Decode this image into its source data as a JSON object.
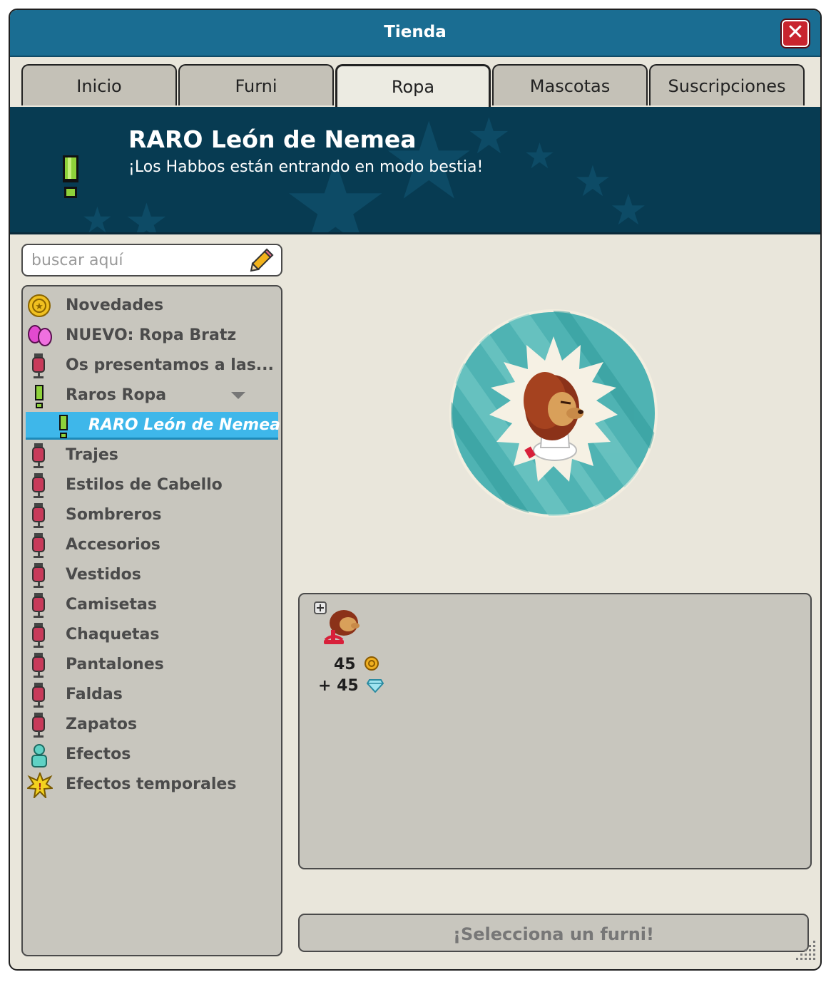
{
  "window": {
    "title": "Tienda",
    "close_label": "✕"
  },
  "tabs": [
    {
      "label": "Inicio",
      "active": false
    },
    {
      "label": "Furni",
      "active": false
    },
    {
      "label": "Ropa",
      "active": true
    },
    {
      "label": "Mascotas",
      "active": false
    },
    {
      "label": "Suscripciones",
      "active": false
    }
  ],
  "banner": {
    "title": "RARO León de Nemea",
    "subtitle": "¡Los Habbos están entrando en modo bestia!"
  },
  "search": {
    "placeholder": "buscar aquí",
    "value": ""
  },
  "categories": [
    {
      "label": "Novedades",
      "icon": "coin-star-icon"
    },
    {
      "label": "NUEVO: Ropa Bratz",
      "icon": "pink-shoes-icon"
    },
    {
      "label": "Os presentamos a las... ¡BR",
      "icon": "mannequin-icon"
    },
    {
      "label": "Raros Ropa",
      "icon": "exclamation-icon",
      "expanded": true
    },
    {
      "label": "RARO León de Nemea",
      "icon": "exclamation-icon",
      "selected": true
    },
    {
      "label": "Trajes",
      "icon": "mannequin-icon"
    },
    {
      "label": "Estilos de Cabello",
      "icon": "mannequin-icon"
    },
    {
      "label": "Sombreros",
      "icon": "mannequin-icon"
    },
    {
      "label": "Accesorios",
      "icon": "mannequin-icon"
    },
    {
      "label": "Vestidos",
      "icon": "mannequin-icon"
    },
    {
      "label": "Camisetas",
      "icon": "mannequin-icon"
    },
    {
      "label": "Chaquetas",
      "icon": "mannequin-icon"
    },
    {
      "label": "Pantalones",
      "icon": "mannequin-icon"
    },
    {
      "label": "Faldas",
      "icon": "mannequin-icon"
    },
    {
      "label": "Zapatos",
      "icon": "mannequin-icon"
    },
    {
      "label": "Efectos",
      "icon": "avatar-effect-icon"
    },
    {
      "label": "Efectos temporales",
      "icon": "explosion-icon"
    }
  ],
  "item": {
    "price_credits": "45",
    "price_diamonds": "+ 45",
    "icons": [
      "lion-head-icon",
      "coin-icon",
      "diamond-icon"
    ]
  },
  "buy_button": {
    "label": "¡Selecciona un furni!"
  },
  "colors": {
    "titlebar": "#1a6d92",
    "banner": "#073b52",
    "selected": "#3eb7ea",
    "panel": "#c8c6be",
    "window": "#e9e6db"
  }
}
